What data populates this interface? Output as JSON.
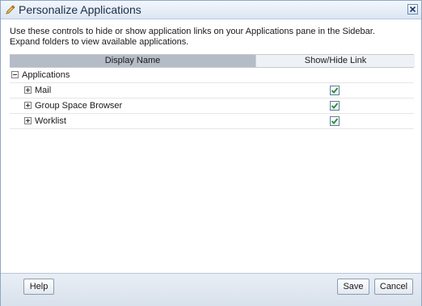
{
  "dialog": {
    "title": "Personalize Applications",
    "title_icon": "pencil-icon",
    "close_icon": "close-icon"
  },
  "instructions": {
    "line1": "Use these controls to hide or show application links on your Applications pane in the Sidebar.",
    "line2": "Expand folders to view available applications."
  },
  "table": {
    "headers": {
      "display_name": "Display Name",
      "show_hide": "Show/Hide Link"
    },
    "root": {
      "label": "Applications",
      "expanded": true
    },
    "rows": [
      {
        "label": "Mail",
        "expanded": false,
        "checked": true
      },
      {
        "label": "Group Space Browser",
        "expanded": false,
        "checked": true
      },
      {
        "label": "Worklist",
        "expanded": false,
        "checked": true
      }
    ]
  },
  "footer": {
    "help_label": "Help",
    "save_label": "Save",
    "cancel_label": "Cancel"
  },
  "colors": {
    "checkmark": "#2f8a2f",
    "header_selected": "#b4bcc7"
  }
}
